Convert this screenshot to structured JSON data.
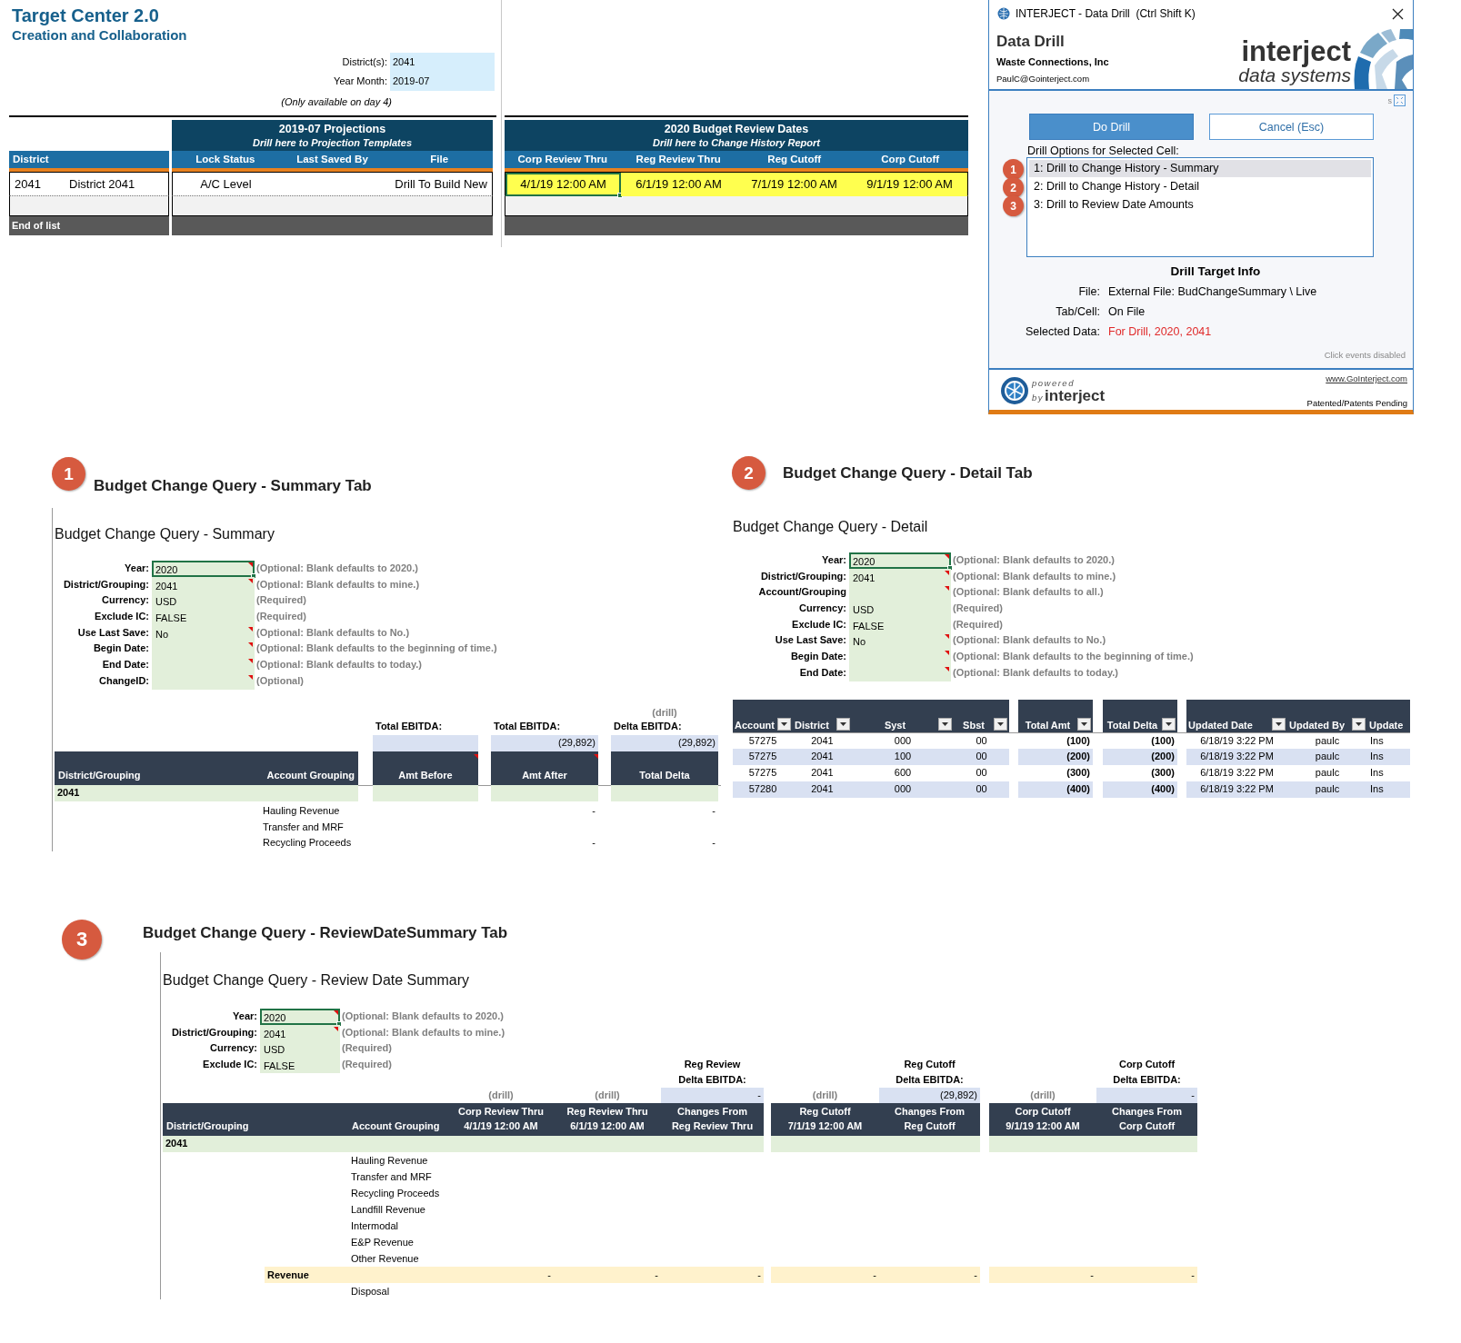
{
  "sheet": {
    "title": "Target Center 2.0",
    "subtitle": "Creation and Collaboration",
    "params": [
      {
        "label": "District(s):",
        "value": "2041"
      },
      {
        "label": "Year Month:",
        "value": "2019-07"
      }
    ],
    "note": "(Only available on day 4)",
    "district_table": {
      "header": "District",
      "row": [
        "2041",
        "District 2041"
      ],
      "footer": "End of list"
    },
    "projections": {
      "title": "2019-07 Projections",
      "subtitle": "Drill here to Projection Templates",
      "columns": [
        "Lock Status",
        "Last Saved By",
        "File"
      ],
      "lock_status": "A/C Level",
      "file": "Drill To Build New"
    },
    "review_dates": {
      "title": "2020 Budget Review Dates",
      "subtitle": "Drill here to Change History Report",
      "columns": [
        "Corp Review Thru",
        "Reg Review Thru",
        "Reg Cutoff",
        "Corp Cutoff"
      ],
      "values": [
        {
          "text": "4/1/19 12:00 AM",
          "selected": true
        },
        {
          "text": "6/1/19 12:00 AM",
          "selected": false
        },
        {
          "text": "7/1/19 12:00 AM",
          "selected": false
        },
        {
          "text": "9/1/19 12:00 AM",
          "selected": false
        }
      ]
    }
  },
  "dialog": {
    "title": "INTERJECT - Data Drill  (Ctrl Shift K)",
    "heading": "Data Drill",
    "company": "Waste Connections, Inc",
    "email": "PaulC@Gointerject.com",
    "logo_word": "interject",
    "logo_tagline": "data systems",
    "size_toggle": "s",
    "buttons": [
      {
        "label": "Do Drill",
        "primary": true
      },
      {
        "label": "Cancel (Esc)",
        "primary": false
      }
    ],
    "options_label": "Drill Options for Selected Cell:",
    "options": [
      {
        "badge": "1",
        "label": "1: Drill to Change History - Summary",
        "selected": true
      },
      {
        "badge": "2",
        "label": "2: Drill to Change History - Detail",
        "selected": false
      },
      {
        "badge": "3",
        "label": "3: Drill to Review Date Amounts",
        "selected": false
      }
    ],
    "target_heading": "Drill Target Info",
    "target_fields": [
      {
        "label": "File:",
        "value": "External File: BudChangeSummary \\ Live",
        "highlight": false
      },
      {
        "label": "Tab/Cell:",
        "value": "On File",
        "highlight": false
      },
      {
        "label": "Selected Data:",
        "value": "For Drill, 2020, 2041",
        "highlight": true
      }
    ],
    "status": "Click events disabled",
    "powered": "powered",
    "by": "by",
    "brand": "interject",
    "link": "www.GoInterject.com",
    "patent": "Patented/Patents Pending"
  },
  "summary": {
    "badge": "1",
    "heading": "Budget Change Query - Summary Tab",
    "sheet_title": "Budget Change Query - Summary",
    "params": [
      {
        "label": "Year:",
        "value": "2020",
        "hint": "(Optional: Blank defaults to 2020.)",
        "comment": true,
        "selected": true
      },
      {
        "label": "District/Grouping:",
        "value": "2041",
        "hint": "(Optional: Blank defaults to mine.)",
        "comment": true,
        "selected": false
      },
      {
        "label": "Currency:",
        "value": "USD",
        "hint": "(Required)",
        "comment": false,
        "selected": false
      },
      {
        "label": "Exclude IC:",
        "value": "FALSE",
        "hint": "(Required)",
        "comment": false,
        "selected": false
      },
      {
        "label": "Use Last Save:",
        "value": "No",
        "hint": "(Optional: Blank defaults to No.)",
        "comment": true,
        "selected": false
      },
      {
        "label": "Begin Date:",
        "hint": "(Optional: Blank defaults to the beginning of time.)",
        "comment": true,
        "selected": false
      },
      {
        "label": "End Date:",
        "hint": "(Optional: Blank defaults to today.)",
        "comment": true,
        "selected": false
      },
      {
        "label": "ChangeID:",
        "hint": "(Optional)",
        "comment": true,
        "selected": false
      }
    ],
    "totals": [
      {
        "label": "Total EBITDA:"
      },
      {
        "label": "Total EBITDA:",
        "value": "(29,892)"
      },
      {
        "drill": "(drill)",
        "label": "Delta EBITDA:",
        "value": "(29,892)"
      }
    ],
    "columns": [
      {
        "label": "District/Grouping",
        "comment": false
      },
      {
        "label": "Account Grouping",
        "comment": false
      },
      {
        "label": "Amt Before",
        "comment": true
      },
      {
        "label": "Amt After",
        "comment": true
      },
      {
        "label": "Total Delta",
        "comment": false
      }
    ],
    "group": "2041",
    "rows": [
      {
        "account": "Hauling Revenue",
        "amt_after": "-",
        "total_delta": "-"
      },
      {
        "account": "Transfer and MRF"
      },
      {
        "account": "Recycling Proceeds",
        "amt_after": "-",
        "total_delta": "-"
      }
    ]
  },
  "detail": {
    "badge": "2",
    "heading": "Budget Change Query - Detail Tab",
    "sheet_title": "Budget Change Query - Detail",
    "params": [
      {
        "label": "Year:",
        "value": "2020",
        "hint": "(Optional: Blank defaults to 2020.)",
        "comment": true,
        "selected": true
      },
      {
        "label": "District/Grouping:",
        "value": "2041",
        "hint": "(Optional: Blank defaults to mine.)",
        "comment": true,
        "selected": false
      },
      {
        "label": "Account/Grouping",
        "hint": "(Optional: Blank defaults to all.)",
        "comment": true,
        "selected": false
      },
      {
        "label": "Currency:",
        "value": "USD",
        "hint": "(Required)",
        "comment": false,
        "selected": false
      },
      {
        "label": "Exclude IC:",
        "value": "FALSE",
        "hint": "(Required)",
        "comment": false,
        "selected": false
      },
      {
        "label": "Use Last Save:",
        "value": "No",
        "hint": "(Optional: Blank defaults to No.)",
        "comment": true,
        "selected": false
      },
      {
        "label": "Begin Date:",
        "hint": "(Optional: Blank defaults to the beginning of time.)",
        "comment": true,
        "selected": false
      },
      {
        "label": "End Date:",
        "hint": "(Optional: Blank defaults to today.)",
        "comment": true,
        "selected": false
      }
    ],
    "column_groups": [
      [
        "Account",
        "District",
        "Syst",
        "Sbst"
      ],
      [
        "Total Amt"
      ],
      [
        "Total Delta"
      ],
      [
        "Updated Date",
        "Updated By",
        "Update"
      ]
    ],
    "rows": [
      [
        "57275",
        "2041",
        "000",
        "00",
        "(100)",
        "(100)",
        "6/18/19 3:22 PM",
        "paulc",
        "Ins"
      ],
      [
        "57275",
        "2041",
        "100",
        "00",
        "(200)",
        "(200)",
        "6/18/19 3:22 PM",
        "paulc",
        "Ins"
      ],
      [
        "57275",
        "2041",
        "600",
        "00",
        "(300)",
        "(300)",
        "6/18/19 3:22 PM",
        "paulc",
        "Ins"
      ],
      [
        "57280",
        "2041",
        "000",
        "00",
        "(400)",
        "(400)",
        "6/18/19 3:22 PM",
        "paulc",
        "Ins"
      ]
    ]
  },
  "review": {
    "badge": "3",
    "heading": "Budget Change Query - ReviewDateSummary Tab",
    "sheet_title": "Budget Change Query - Review Date Summary",
    "params": [
      {
        "label": "Year:",
        "value": "2020",
        "hint": "(Optional: Blank defaults to 2020.)",
        "comment": true,
        "selected": true
      },
      {
        "label": "District/Grouping:",
        "value": "2041",
        "hint": "(Optional: Blank defaults to mine.)",
        "comment": true,
        "selected": false
      },
      {
        "label": "Currency:",
        "value": "USD",
        "hint": "(Required)",
        "comment": false,
        "selected": false
      },
      {
        "label": "Exclude IC:",
        "value": "FALSE",
        "hint": "(Required)",
        "comment": false,
        "selected": false
      }
    ],
    "columns": [
      "District/Grouping",
      "Account Grouping"
    ],
    "groups": [
      [
        {
          "title": "Corp Review Thru",
          "date": "4/1/19 12:00 AM",
          "drill": "(drill)"
        },
        {
          "title": "Reg Review Thru",
          "date": "6/1/19 12:00 AM",
          "drill": "(drill)"
        },
        {
          "title": "Changes From",
          "date": "Reg Review Thru",
          "total_label": "Reg Review",
          "total_caption": "Delta EBITDA:",
          "total": "-"
        }
      ],
      [
        {
          "title": "Reg Cutoff",
          "date": "7/1/19 12:00 AM",
          "drill": "(drill)"
        },
        {
          "title": "Changes From",
          "date": "Reg Cutoff",
          "total_label": "Reg Cutoff",
          "total_caption": "Delta EBITDA:",
          "total": "(29,892)"
        }
      ],
      [
        {
          "title": "Corp Cutoff",
          "date": "9/1/19 12:00 AM",
          "drill": "(drill)"
        },
        {
          "title": "Changes From",
          "date": "Corp Cutoff",
          "total_label": "Corp Cutoff",
          "total_caption": "Delta EBITDA:",
          "total": "-"
        }
      ]
    ],
    "group": "2041",
    "rows": [
      {
        "kind": "account",
        "label": "Hauling Revenue"
      },
      {
        "kind": "account",
        "label": "Transfer and MRF"
      },
      {
        "kind": "account",
        "label": "Recycling Proceeds"
      },
      {
        "kind": "account",
        "label": "Landfill Revenue"
      },
      {
        "kind": "account",
        "label": "Intermodal"
      },
      {
        "kind": "account",
        "label": "E&P Revenue"
      },
      {
        "kind": "account",
        "label": "Other Revenue"
      },
      {
        "kind": "subtotal",
        "label": "Revenue",
        "values": [
          "-",
          "-",
          "-",
          "-",
          "-",
          "-",
          "-"
        ]
      },
      {
        "kind": "account",
        "label": "Disposal"
      }
    ]
  }
}
